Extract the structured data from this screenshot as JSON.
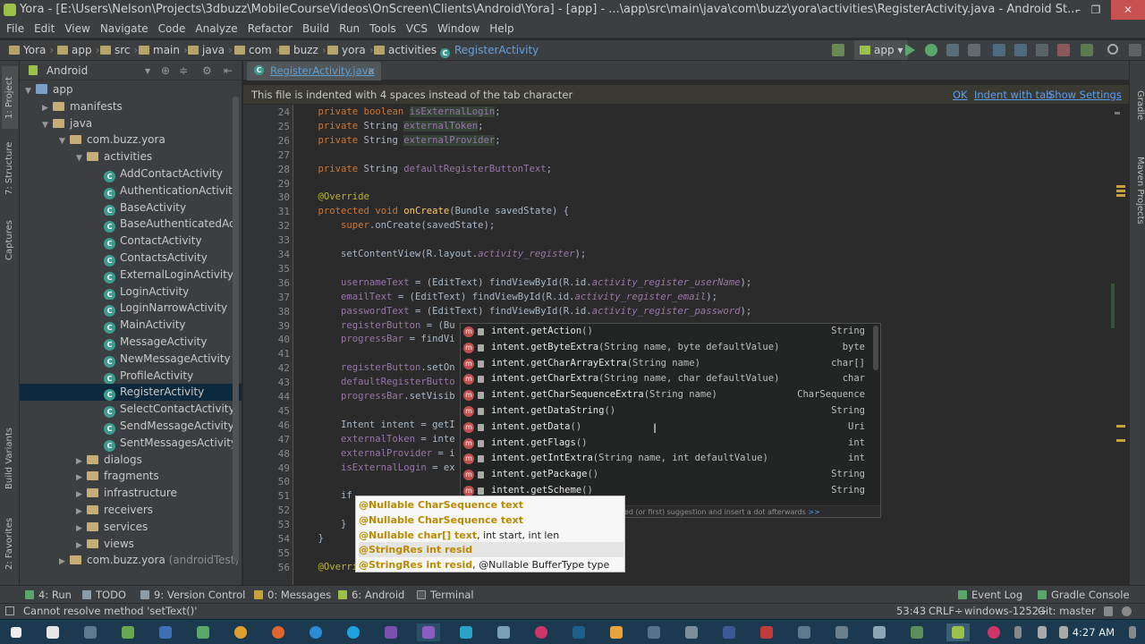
{
  "window": {
    "title": "Yora - [E:\\Users\\Nelson\\Projects\\3dbuzz\\MobileCourseVideos\\OnScreen\\Clients\\Android\\Yora] - [app] - ...\\app\\src\\main\\java\\com\\buzz\\yora\\activities\\RegisterActivity.java - Android St...",
    "min": "–",
    "max": "❐",
    "close": "✕"
  },
  "menu": [
    "File",
    "Edit",
    "View",
    "Navigate",
    "Code",
    "Analyze",
    "Refactor",
    "Build",
    "Run",
    "Tools",
    "VCS",
    "Window",
    "Help"
  ],
  "breadcrumbs": [
    "Yora",
    "app",
    "src",
    "main",
    "java",
    "com",
    "buzz",
    "yora",
    "activities",
    "RegisterActivity"
  ],
  "run_config": "app",
  "side_tabs": {
    "project": "1: Project",
    "structure": "7: Structure",
    "captures": "Captures",
    "build_variants": "Build Variants",
    "favorites": "2: Favorites"
  },
  "right_tabs": {
    "gradle": "Gradle",
    "maven": "Maven Projects"
  },
  "project_view": {
    "mode": "Android",
    "tree": [
      {
        "label": "app",
        "level": 0,
        "kind": "mod",
        "open": true
      },
      {
        "label": "manifests",
        "level": 1,
        "kind": "fold",
        "open": false
      },
      {
        "label": "java",
        "level": 1,
        "kind": "fold",
        "open": true
      },
      {
        "label": "com.buzz.yora",
        "level": 2,
        "kind": "pkg",
        "open": true
      },
      {
        "label": "activities",
        "level": 3,
        "kind": "fold",
        "open": true
      },
      {
        "label": "AddContactActivity",
        "level": 4,
        "kind": "cls"
      },
      {
        "label": "AuthenticationActivity",
        "level": 4,
        "kind": "cls"
      },
      {
        "label": "BaseActivity",
        "level": 4,
        "kind": "cls"
      },
      {
        "label": "BaseAuthenticatedAct",
        "level": 4,
        "kind": "cls"
      },
      {
        "label": "ContactActivity",
        "level": 4,
        "kind": "cls"
      },
      {
        "label": "ContactsActivity",
        "level": 4,
        "kind": "cls"
      },
      {
        "label": "ExternalLoginActivity",
        "level": 4,
        "kind": "cls"
      },
      {
        "label": "LoginActivity",
        "level": 4,
        "kind": "cls"
      },
      {
        "label": "LoginNarrowActivity",
        "level": 4,
        "kind": "cls"
      },
      {
        "label": "MainActivity",
        "level": 4,
        "kind": "cls"
      },
      {
        "label": "MessageActivity",
        "level": 4,
        "kind": "cls"
      },
      {
        "label": "NewMessageActivity",
        "level": 4,
        "kind": "cls"
      },
      {
        "label": "ProfileActivity",
        "level": 4,
        "kind": "cls"
      },
      {
        "label": "RegisterActivity",
        "level": 4,
        "kind": "cls",
        "selected": true
      },
      {
        "label": "SelectContactActivity",
        "level": 4,
        "kind": "cls"
      },
      {
        "label": "SendMessageActivity",
        "level": 4,
        "kind": "cls"
      },
      {
        "label": "SentMessagesActivity",
        "level": 4,
        "kind": "cls"
      },
      {
        "label": "dialogs",
        "level": 3,
        "kind": "fold",
        "open": false
      },
      {
        "label": "fragments",
        "level": 3,
        "kind": "fold",
        "open": false
      },
      {
        "label": "infrastructure",
        "level": 3,
        "kind": "fold",
        "open": false
      },
      {
        "label": "receivers",
        "level": 3,
        "kind": "fold",
        "open": false
      },
      {
        "label": "services",
        "level": 3,
        "kind": "fold",
        "open": false
      },
      {
        "label": "views",
        "level": 3,
        "kind": "fold",
        "open": false
      },
      {
        "label": "com.buzz.yora",
        "suffix": "(androidTest)",
        "level": 2,
        "kind": "pkg",
        "open": false
      }
    ]
  },
  "editor": {
    "tab": "RegisterActivity.java",
    "notification": {
      "text": "This file is indented with 4 spaces instead of the tab character",
      "ok": "OK",
      "indent_tab": "Indent with tab",
      "show_settings": "Show Settings"
    },
    "line_numbers": [
      "24",
      "25",
      "26",
      "27",
      "28",
      "29",
      "30",
      "31",
      "32",
      "33",
      "34",
      "35",
      "36",
      "37",
      "38",
      "39",
      "40",
      "41",
      "42",
      "43",
      "44",
      "45",
      "46",
      "47",
      "48",
      "49",
      "50",
      "51",
      "52",
      "53",
      "54",
      "55",
      "56"
    ],
    "lines": [
      "    private boolean isExternalLogin;",
      "    private String externalToken;",
      "    private String externalProvider;",
      "",
      "    private String defaultRegisterButtonText;",
      "",
      "    @Override",
      "    protected void onCreate(Bundle savedState) {",
      "        super.onCreate(savedState);",
      "",
      "        setContentView(R.layout.activity_register);",
      "",
      "        usernameText = (EditText) findViewById(R.id.activity_register_userName);",
      "        emailText = (EditText) findViewById(R.id.activity_register_email);",
      "        passwordText = (EditText) findViewById(R.id.activity_register_password);",
      "        registerButton = (Bu",
      "        progressBar = findVi",
      "",
      "        registerButton.setOn",
      "        defaultRegisterButto",
      "        progressBar.setVisib",
      "",
      "        Intent intent = getI",
      "        externalToken = inte",
      "        externalProvider = i",
      "        isExternalLogin = ex",
      "",
      "        if",
      "",
      "        }",
      "    }",
      "",
      "    @Override"
    ]
  },
  "completion": {
    "items": [
      {
        "method": "intent.getAction",
        "params": "()",
        "ret": "String"
      },
      {
        "method": "intent.getByteExtra",
        "params": "(String name, byte defaultValue)",
        "ret": "byte"
      },
      {
        "method": "intent.getCharArrayExtra",
        "params": "(String name)",
        "ret": "char[]"
      },
      {
        "method": "intent.getCharExtra",
        "params": "(String name, char defaultValue)",
        "ret": "char"
      },
      {
        "method": "intent.getCharSequenceExtra",
        "params": "(String name)",
        "ret": "CharSequence"
      },
      {
        "method": "intent.getDataString",
        "params": "()",
        "ret": "String"
      },
      {
        "method": "intent.getData",
        "params": "()",
        "ret": "Uri"
      },
      {
        "method": "intent.getFlags",
        "params": "()",
        "ret": "int"
      },
      {
        "method": "intent.getIntExtra",
        "params": "(String name, int defaultValue)",
        "ret": "int"
      },
      {
        "method": "intent.getPackage",
        "params": "()",
        "ret": "String"
      },
      {
        "method": "intent.getScheme",
        "params": "()",
        "ret": "String"
      }
    ],
    "footer": "Press Ctrl+Period to choose the selected (or first) suggestion and insert a dot afterwards",
    "footer_link": ">>"
  },
  "param_info": [
    {
      "bold": "@Nullable CharSequence text",
      "rest": ""
    },
    {
      "bold": "@Nullable CharSequence text",
      "rest": ""
    },
    {
      "bold": "@Nullable char[] text",
      "rest": ", int start, int len"
    },
    {
      "bold": "@StringRes int resid",
      "rest": "",
      "highlight": true
    },
    {
      "bold": "@StringRes int resid",
      "rest": ", @Nullable BufferType type"
    }
  ],
  "tool_windows": {
    "run": "4: Run",
    "todo": "TODO",
    "vc": "9: Version Control",
    "messages": "0: Messages",
    "android": "6: Android",
    "terminal": "Terminal",
    "event_log": "Event Log",
    "gradle_console": "Gradle Console"
  },
  "status": {
    "message": "Cannot resolve method 'setText()'",
    "position": "53:43",
    "line_sep": "CRLF÷",
    "encoding": "windows-1252÷",
    "vcs": "Git: master"
  },
  "taskbar": {
    "time": "4:27 AM"
  },
  "colors": {
    "ide_bg": "#2b2b2b",
    "panel": "#3c3f41",
    "selection": "#0d293e",
    "keyword": "#cc7832",
    "field": "#9876aa",
    "link": "#589df6"
  }
}
